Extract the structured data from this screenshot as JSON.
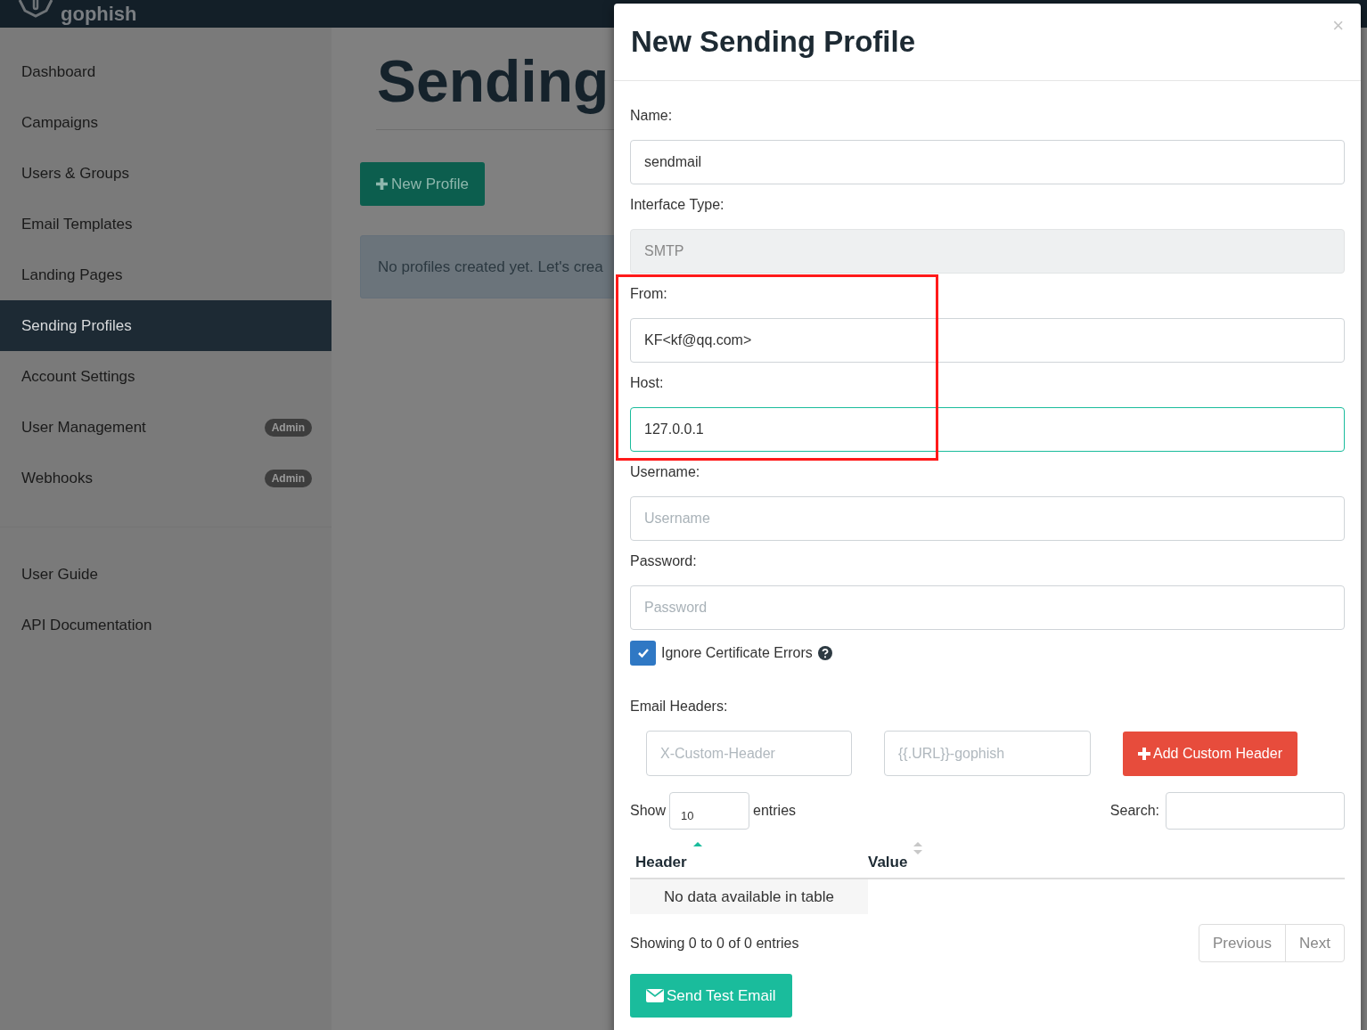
{
  "logo": {
    "text": "gophish"
  },
  "sidebar": {
    "items": [
      {
        "label": "Dashboard",
        "selected": false
      },
      {
        "label": "Campaigns",
        "selected": false
      },
      {
        "label": "Users & Groups",
        "selected": false
      },
      {
        "label": "Email Templates",
        "selected": false
      },
      {
        "label": "Landing Pages",
        "selected": false
      },
      {
        "label": "Sending Profiles",
        "selected": true
      },
      {
        "label": "Account Settings",
        "selected": false
      },
      {
        "label": "User Management",
        "selected": false,
        "badge": "Admin"
      },
      {
        "label": "Webhooks",
        "selected": false,
        "badge": "Admin"
      }
    ],
    "links": [
      "User Guide",
      "API Documentation"
    ]
  },
  "page": {
    "title": "Sending",
    "new_button": "New Profile",
    "alert": "No profiles created yet. Let's crea"
  },
  "modal": {
    "title": "New Sending Profile",
    "close": "×",
    "fields": [
      {
        "label": "Name:",
        "value": "sendmail",
        "disabled": false,
        "focused": false
      },
      {
        "label": "Interface Type:",
        "value": "SMTP",
        "disabled": true,
        "focused": false
      },
      {
        "label": "From:",
        "value": "KF<kf@qq.com>",
        "disabled": false,
        "focused": false
      },
      {
        "label": "Host:",
        "value": "127.0.0.1",
        "disabled": false,
        "focused": true
      },
      {
        "label": "Username:",
        "placeholder": "Username",
        "disabled": false,
        "focused": false
      },
      {
        "label": "Password:",
        "placeholder": "Password",
        "disabled": false,
        "focused": false
      }
    ],
    "checkbox": {
      "label": "Ignore Certificate Errors",
      "checked": true
    },
    "headers": {
      "label": "Email Headers:",
      "name_placeholder": "X-Custom-Header",
      "value_placeholder": "{{.URL}}-gophish",
      "add_button": "Add Custom Header"
    },
    "table": {
      "show": "Show",
      "length": "10",
      "entries": "entries",
      "search_label": "Search:",
      "columns": [
        {
          "label": "Header",
          "sorted": true
        },
        {
          "label": "Value",
          "sorted": false
        }
      ],
      "empty": "No data available in table",
      "info": "Showing 0 to 0 of 0 entries",
      "pagination": [
        "Previous",
        "Next"
      ]
    },
    "send_button": "Send Test Email"
  },
  "annotation": {
    "kind": "highlight"
  }
}
